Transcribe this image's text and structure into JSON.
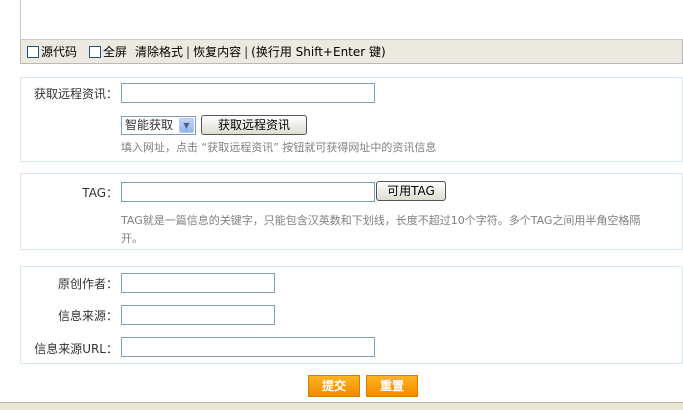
{
  "editor": {
    "source_label": "源代码",
    "fullscreen_label": "全屏",
    "clear_format": "清除格式",
    "separator": "|",
    "restore_content": "恢复内容",
    "linebreak_hint": "(换行用 Shift+Enter 键)"
  },
  "remote": {
    "label": "获取远程资讯：",
    "url_value": "",
    "mode_selected": "智能获取",
    "fetch_button": "获取远程资讯",
    "hint": "填入网址，点击 “获取远程资讯” 按钮就可获得网址中的资讯信息"
  },
  "tag": {
    "label": "TAG：",
    "value": "",
    "available_button": "可用TAG",
    "hint_line1": "TAG就是一篇信息的关键字，只能包含汉英数和下划线，长度不超过10个字符。多个TAG之间用半角空格隔",
    "hint_line2": "开。"
  },
  "source_info": {
    "author_label": "原创作者：",
    "author_value": "",
    "source_label": "信息来源：",
    "source_value": "",
    "source_url_label": "信息来源URL：",
    "source_url_value": ""
  },
  "actions": {
    "submit": "提交",
    "reset": "重置"
  },
  "colors": {
    "accent_orange": "#f9a01b",
    "panel_border": "#d9e8ec",
    "hint_text": "#808080"
  }
}
